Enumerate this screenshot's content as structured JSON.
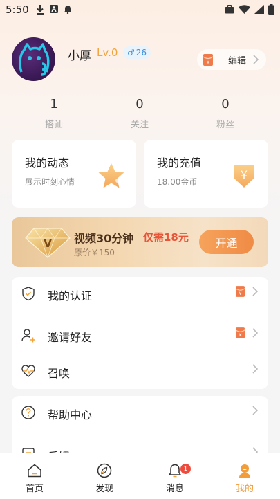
{
  "status_bar": {
    "time": "5:50"
  },
  "profile": {
    "name": "小厚",
    "level": "Lv.0",
    "gender_symbol": "♂",
    "age": "26",
    "edit_label": "编辑"
  },
  "stats": [
    {
      "value": "1",
      "label": "搭讪"
    },
    {
      "value": "0",
      "label": "关注"
    },
    {
      "value": "0",
      "label": "粉丝"
    }
  ],
  "cards": {
    "moments": {
      "title": "我的动态",
      "subtitle": "展示时刻心情",
      "icon": "star-icon"
    },
    "recharge": {
      "title": "我的充值",
      "subtitle": "18.00金币",
      "icon": "yen-coin-icon"
    }
  },
  "vip": {
    "title": "视频30分钟",
    "price": "仅需18元",
    "original_price": "原价￥150",
    "button_label": "开通",
    "badge_letter": "V"
  },
  "menu_group_1": [
    {
      "label": "我的认证",
      "icon": "shield-check-icon",
      "has_tag": true
    },
    {
      "label": "邀请好友",
      "icon": "add-user-icon",
      "has_tag": true
    },
    {
      "label": "召唤",
      "icon": "heartbeat-icon",
      "has_tag": false
    }
  ],
  "menu_group_2": [
    {
      "label": "帮助中心",
      "icon": "question-icon"
    },
    {
      "label": "反馈",
      "icon": "feedback-icon"
    }
  ],
  "tabbar": [
    {
      "label": "首页",
      "icon": "home-icon",
      "active": false
    },
    {
      "label": "发现",
      "icon": "compass-icon",
      "active": false
    },
    {
      "label": "消息",
      "icon": "bell-icon",
      "active": false,
      "badge": "1"
    },
    {
      "label": "我的",
      "icon": "profile-icon",
      "active": true
    }
  ],
  "colors": {
    "accent": "#f29c3a",
    "level": "#f2a33a",
    "price_red": "#e8563a",
    "badge_red": "#f04a3c",
    "tag_orange": "#f07a4a"
  }
}
